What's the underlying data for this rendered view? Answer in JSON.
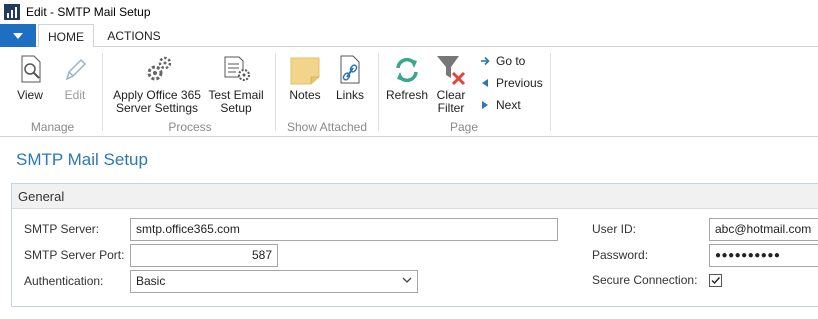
{
  "window": {
    "title": "Edit - SMTP Mail Setup"
  },
  "tabs": [
    {
      "label": "HOME"
    },
    {
      "label": "ACTIONS"
    }
  ],
  "ribbon": {
    "manage": {
      "label": "Manage",
      "view": "View",
      "edit": "Edit"
    },
    "process": {
      "label": "Process",
      "apply_line1": "Apply Office 365",
      "apply_line2": "Server Settings",
      "test_line1": "Test Email",
      "test_line2": "Setup"
    },
    "show_attached": {
      "label": "Show Attached",
      "notes": "Notes",
      "links": "Links"
    },
    "page": {
      "label": "Page",
      "refresh": "Refresh",
      "clear_line1": "Clear",
      "clear_line2": "Filter",
      "goto": "Go to",
      "previous": "Previous",
      "next": "Next"
    }
  },
  "page": {
    "title": "SMTP Mail Setup"
  },
  "general": {
    "header": "General",
    "smtp_server_label": "SMTP Server:",
    "smtp_server_value": "smtp.office365.com",
    "smtp_port_label": "SMTP Server Port:",
    "smtp_port_value": "587",
    "auth_label": "Authentication:",
    "auth_value": "Basic",
    "user_id_label": "User ID:",
    "user_id_value": "abc@hotmail.com",
    "password_label": "Password:",
    "password_value": "●●●●●●●●●●",
    "secure_label": "Secure Connection:",
    "secure_checked": true
  },
  "colors": {
    "accent": "#2c77b8",
    "appmenu": "#1e6fc1",
    "refresh": "#3aa68a",
    "clear_x": "#e0463a"
  }
}
